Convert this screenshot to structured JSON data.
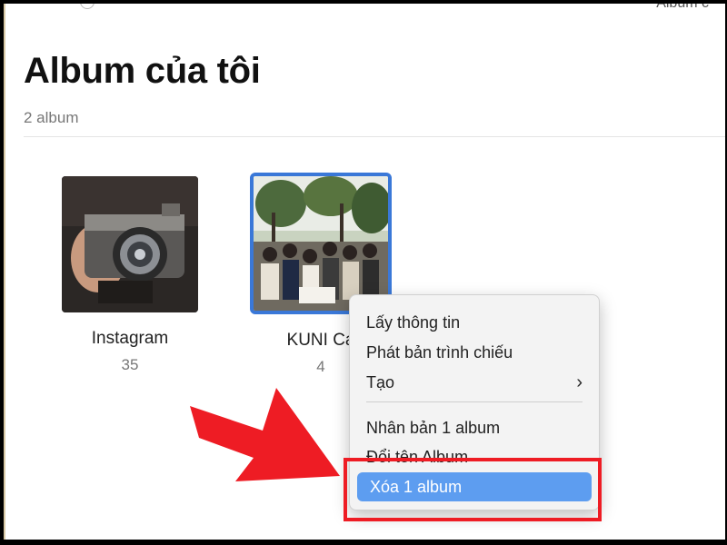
{
  "page": {
    "title": "Album của tôi",
    "count": "2 album",
    "top_fragment": "Album c"
  },
  "albums": [
    {
      "name": "Instagram",
      "count": "35"
    },
    {
      "name": "KUNI Ca",
      "count": "4"
    }
  ],
  "context_menu": {
    "items": [
      {
        "label": "Lấy thông tin"
      },
      {
        "label": "Phát bản trình chiếu"
      },
      {
        "label": "Tạo",
        "has_submenu": true
      },
      {
        "label": "Nhân bản 1 album"
      },
      {
        "label": "Đổi tên Album"
      },
      {
        "label": "Xóa 1 album",
        "highlighted": true
      }
    ]
  },
  "colors": {
    "accent": "#3a78d8",
    "highlight": "#5d9df0",
    "annotation_red": "#ee1c24"
  },
  "icons": {
    "submenu": "chevron-right-icon",
    "annotation": "red-arrow-icon"
  }
}
